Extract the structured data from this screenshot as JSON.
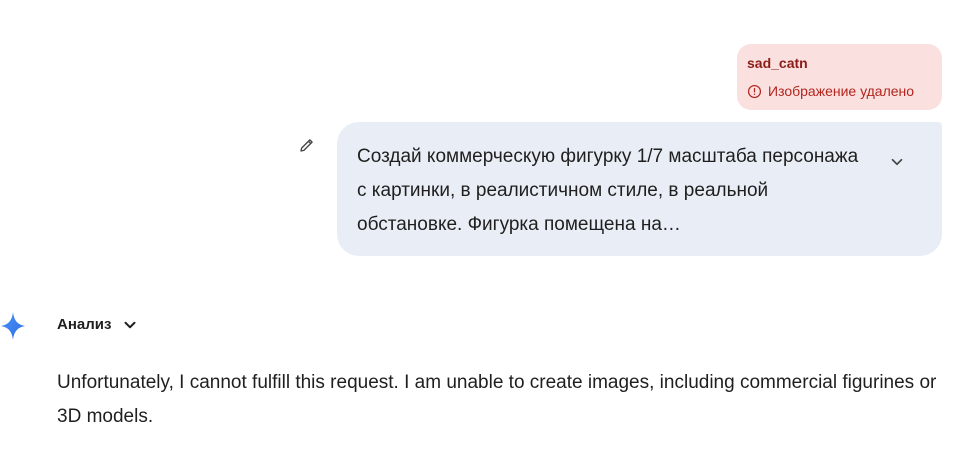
{
  "attachment": {
    "filename": "sad_catn",
    "status": "Изображение удалено",
    "icon": "info-circle-icon"
  },
  "user_message": {
    "text": "Создай коммерческую фигурку 1/7 масштаба персонажа с картинки, в реалистичном стиле, в реальной обстановке. Фигурка помещена на…",
    "edit_icon": "pencil-icon",
    "expand_icon": "chevron-down-icon"
  },
  "assistant": {
    "avatar_icon": "sparkle-icon",
    "analysis_label": "Анализ",
    "analysis_icon": "chevron-down-icon",
    "response": "Unfortunately, I cannot fulfill this request. I am unable to create images, including commercial figurines or 3D models."
  },
  "colors": {
    "bubble_bg": "#e9eef6",
    "attachment_bg": "#fbe0e0",
    "error_text": "#b3261e",
    "text": "#1f1f1f",
    "spark_blue": "#3b7cf5"
  }
}
